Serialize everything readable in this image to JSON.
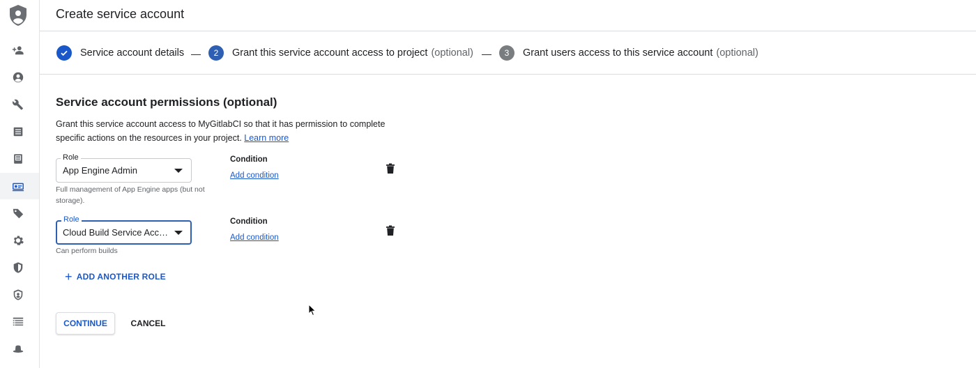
{
  "header": {
    "title": "Create service account"
  },
  "stepper": {
    "steps": [
      {
        "label": "Service account details",
        "optional": "",
        "status": "done",
        "number": ""
      },
      {
        "label": "Grant this service account access to project",
        "optional": "(optional)",
        "status": "current",
        "number": "2"
      },
      {
        "label": "Grant users access to this service account",
        "optional": "(optional)",
        "status": "future",
        "number": "3"
      }
    ],
    "separator": "—"
  },
  "permissions": {
    "title": "Service account permissions (optional)",
    "description": "Grant this service account access to MyGitlabCI so that it has permission to complete specific actions on the resources in your project.",
    "learn_more": "Learn more",
    "roles": [
      {
        "legend": "Role",
        "value": "App Engine Admin",
        "help": "Full management of App Engine apps (but not storage).",
        "condition_label": "Condition",
        "add_condition": "Add condition"
      },
      {
        "legend": "Role",
        "value": "Cloud Build Service Account",
        "help": "Can perform builds",
        "condition_label": "Condition",
        "add_condition": "Add condition"
      }
    ],
    "add_another_role": "ADD ANOTHER ROLE"
  },
  "actions": {
    "continue": "CONTINUE",
    "cancel": "CANCEL"
  },
  "rail": {
    "icons": [
      "shield-logo-icon",
      "person-add-icon",
      "account-circle-icon",
      "wrench-icon",
      "list-icon",
      "storage-icon",
      "service-account-icon",
      "label-icon",
      "settings-gear-icon",
      "security-shield-icon",
      "privacy-shield-icon",
      "list-alt-icon",
      "hat-icon"
    ],
    "active": "service-account-icon"
  },
  "colors": {
    "accent": "#1a57c8",
    "border": "#dadce0",
    "text": "#202124",
    "muted": "#5f6368"
  }
}
